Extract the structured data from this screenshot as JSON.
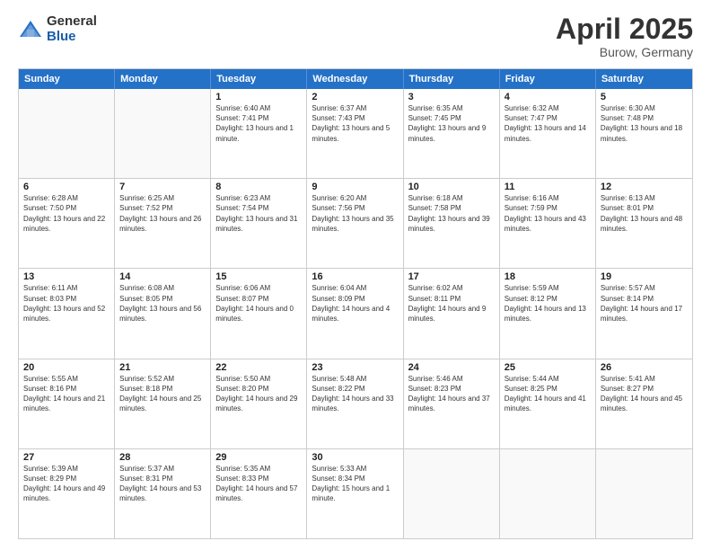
{
  "header": {
    "logo_general": "General",
    "logo_blue": "Blue",
    "month_title": "April 2025",
    "location": "Burow, Germany"
  },
  "days_of_week": [
    "Sunday",
    "Monday",
    "Tuesday",
    "Wednesday",
    "Thursday",
    "Friday",
    "Saturday"
  ],
  "rows": [
    [
      {
        "day": "",
        "info": ""
      },
      {
        "day": "",
        "info": ""
      },
      {
        "day": "1",
        "info": "Sunrise: 6:40 AM\nSunset: 7:41 PM\nDaylight: 13 hours and 1 minute."
      },
      {
        "day": "2",
        "info": "Sunrise: 6:37 AM\nSunset: 7:43 PM\nDaylight: 13 hours and 5 minutes."
      },
      {
        "day": "3",
        "info": "Sunrise: 6:35 AM\nSunset: 7:45 PM\nDaylight: 13 hours and 9 minutes."
      },
      {
        "day": "4",
        "info": "Sunrise: 6:32 AM\nSunset: 7:47 PM\nDaylight: 13 hours and 14 minutes."
      },
      {
        "day": "5",
        "info": "Sunrise: 6:30 AM\nSunset: 7:48 PM\nDaylight: 13 hours and 18 minutes."
      }
    ],
    [
      {
        "day": "6",
        "info": "Sunrise: 6:28 AM\nSunset: 7:50 PM\nDaylight: 13 hours and 22 minutes."
      },
      {
        "day": "7",
        "info": "Sunrise: 6:25 AM\nSunset: 7:52 PM\nDaylight: 13 hours and 26 minutes."
      },
      {
        "day": "8",
        "info": "Sunrise: 6:23 AM\nSunset: 7:54 PM\nDaylight: 13 hours and 31 minutes."
      },
      {
        "day": "9",
        "info": "Sunrise: 6:20 AM\nSunset: 7:56 PM\nDaylight: 13 hours and 35 minutes."
      },
      {
        "day": "10",
        "info": "Sunrise: 6:18 AM\nSunset: 7:58 PM\nDaylight: 13 hours and 39 minutes."
      },
      {
        "day": "11",
        "info": "Sunrise: 6:16 AM\nSunset: 7:59 PM\nDaylight: 13 hours and 43 minutes."
      },
      {
        "day": "12",
        "info": "Sunrise: 6:13 AM\nSunset: 8:01 PM\nDaylight: 13 hours and 48 minutes."
      }
    ],
    [
      {
        "day": "13",
        "info": "Sunrise: 6:11 AM\nSunset: 8:03 PM\nDaylight: 13 hours and 52 minutes."
      },
      {
        "day": "14",
        "info": "Sunrise: 6:08 AM\nSunset: 8:05 PM\nDaylight: 13 hours and 56 minutes."
      },
      {
        "day": "15",
        "info": "Sunrise: 6:06 AM\nSunset: 8:07 PM\nDaylight: 14 hours and 0 minutes."
      },
      {
        "day": "16",
        "info": "Sunrise: 6:04 AM\nSunset: 8:09 PM\nDaylight: 14 hours and 4 minutes."
      },
      {
        "day": "17",
        "info": "Sunrise: 6:02 AM\nSunset: 8:11 PM\nDaylight: 14 hours and 9 minutes."
      },
      {
        "day": "18",
        "info": "Sunrise: 5:59 AM\nSunset: 8:12 PM\nDaylight: 14 hours and 13 minutes."
      },
      {
        "day": "19",
        "info": "Sunrise: 5:57 AM\nSunset: 8:14 PM\nDaylight: 14 hours and 17 minutes."
      }
    ],
    [
      {
        "day": "20",
        "info": "Sunrise: 5:55 AM\nSunset: 8:16 PM\nDaylight: 14 hours and 21 minutes."
      },
      {
        "day": "21",
        "info": "Sunrise: 5:52 AM\nSunset: 8:18 PM\nDaylight: 14 hours and 25 minutes."
      },
      {
        "day": "22",
        "info": "Sunrise: 5:50 AM\nSunset: 8:20 PM\nDaylight: 14 hours and 29 minutes."
      },
      {
        "day": "23",
        "info": "Sunrise: 5:48 AM\nSunset: 8:22 PM\nDaylight: 14 hours and 33 minutes."
      },
      {
        "day": "24",
        "info": "Sunrise: 5:46 AM\nSunset: 8:23 PM\nDaylight: 14 hours and 37 minutes."
      },
      {
        "day": "25",
        "info": "Sunrise: 5:44 AM\nSunset: 8:25 PM\nDaylight: 14 hours and 41 minutes."
      },
      {
        "day": "26",
        "info": "Sunrise: 5:41 AM\nSunset: 8:27 PM\nDaylight: 14 hours and 45 minutes."
      }
    ],
    [
      {
        "day": "27",
        "info": "Sunrise: 5:39 AM\nSunset: 8:29 PM\nDaylight: 14 hours and 49 minutes."
      },
      {
        "day": "28",
        "info": "Sunrise: 5:37 AM\nSunset: 8:31 PM\nDaylight: 14 hours and 53 minutes."
      },
      {
        "day": "29",
        "info": "Sunrise: 5:35 AM\nSunset: 8:33 PM\nDaylight: 14 hours and 57 minutes."
      },
      {
        "day": "30",
        "info": "Sunrise: 5:33 AM\nSunset: 8:34 PM\nDaylight: 15 hours and 1 minute."
      },
      {
        "day": "",
        "info": ""
      },
      {
        "day": "",
        "info": ""
      },
      {
        "day": "",
        "info": ""
      }
    ]
  ]
}
